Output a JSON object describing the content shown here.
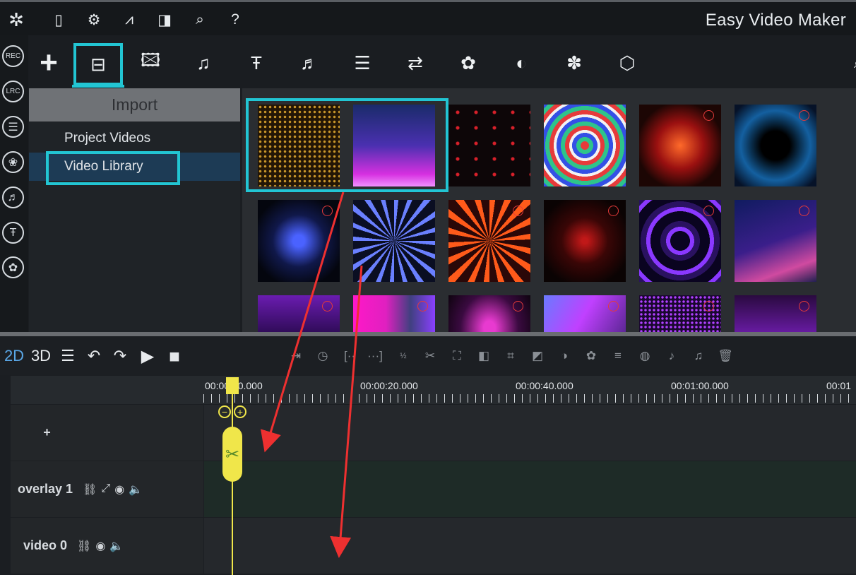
{
  "app": {
    "title": "Easy Video Maker"
  },
  "topbar": {
    "icons": [
      "magic-wand-icon",
      "book-icon",
      "gear-icon",
      "signal-icon",
      "layout-icon",
      "search-icon",
      "help-icon"
    ],
    "glyphs": [
      "✲",
      "▯",
      "⚙",
      "⩘",
      "◨",
      "⌕",
      "?"
    ]
  },
  "leftrail": {
    "buttons": [
      {
        "name": "rec-button",
        "label": "REC"
      },
      {
        "name": "lrc-button",
        "label": "LRC"
      },
      {
        "name": "list-button",
        "label": "☰"
      },
      {
        "name": "effects-button",
        "label": "❀"
      },
      {
        "name": "lyrics-button",
        "label": "♬"
      },
      {
        "name": "text-button",
        "label": "Ŧ"
      },
      {
        "name": "shape-button",
        "label": "✿"
      }
    ]
  },
  "mediabar": {
    "add_glyph": "+",
    "items": [
      {
        "name": "video-tab",
        "glyph": "⊟"
      },
      {
        "name": "image-tab",
        "glyph": "🖾"
      },
      {
        "name": "music-tab",
        "glyph": "♫"
      },
      {
        "name": "text-tab",
        "glyph": "Ŧ"
      },
      {
        "name": "lyrics-tab",
        "glyph": "♬"
      },
      {
        "name": "list-tab",
        "glyph": "☰"
      },
      {
        "name": "transition-tab",
        "glyph": "⇄"
      },
      {
        "name": "sticker-tab",
        "glyph": "✿"
      },
      {
        "name": "filter-tab",
        "glyph": "◐"
      },
      {
        "name": "effect-tab",
        "glyph": "✽"
      },
      {
        "name": "3d-tab",
        "glyph": "⬡"
      }
    ]
  },
  "import_panel": {
    "header": "Import",
    "items": [
      "Project Videos",
      "Video Library"
    ],
    "selected": "Video Library"
  },
  "gallery": {
    "thumbnails": [
      {
        "name": "gold-dots"
      },
      {
        "name": "purple-city"
      },
      {
        "name": "red-lights"
      },
      {
        "name": "color-wheel"
      },
      {
        "name": "red-star"
      },
      {
        "name": "blue-tunnel"
      },
      {
        "name": "blue-flowers"
      },
      {
        "name": "blue-rays"
      },
      {
        "name": "red-orb"
      },
      {
        "name": "red-shards"
      },
      {
        "name": "purple-ring"
      },
      {
        "name": "blue-triangle"
      },
      {
        "name": "purple-stage"
      },
      {
        "name": "pink-dome"
      },
      {
        "name": "pink-crown"
      },
      {
        "name": "violet-lights"
      },
      {
        "name": "purple-grid"
      },
      {
        "name": "purple-tunnel"
      }
    ]
  },
  "timeline_toolbar": {
    "mode_2d": "2D",
    "mode_3d": "3D",
    "left_glyphs": [
      "☰",
      "↶",
      "↷",
      "▶",
      "■"
    ],
    "tool_glyphs": [
      "⇥",
      "◷",
      "[··",
      "···]",
      "½",
      "✂",
      "⛶",
      "◧",
      "⌗",
      "◩",
      "◑",
      "✿",
      "≡",
      "◍",
      "♪",
      "♫",
      "🗑"
    ]
  },
  "ruler": {
    "labels": [
      "00:00:00.000",
      "00:00:20.000",
      "00:00:40.000",
      "00:01:00.000",
      "00:01"
    ]
  },
  "tracks": [
    {
      "name": "add-track",
      "label": "+"
    },
    {
      "name": "overlay-1",
      "label": "overlay 1"
    },
    {
      "name": "video-0",
      "label": "video 0"
    }
  ]
}
